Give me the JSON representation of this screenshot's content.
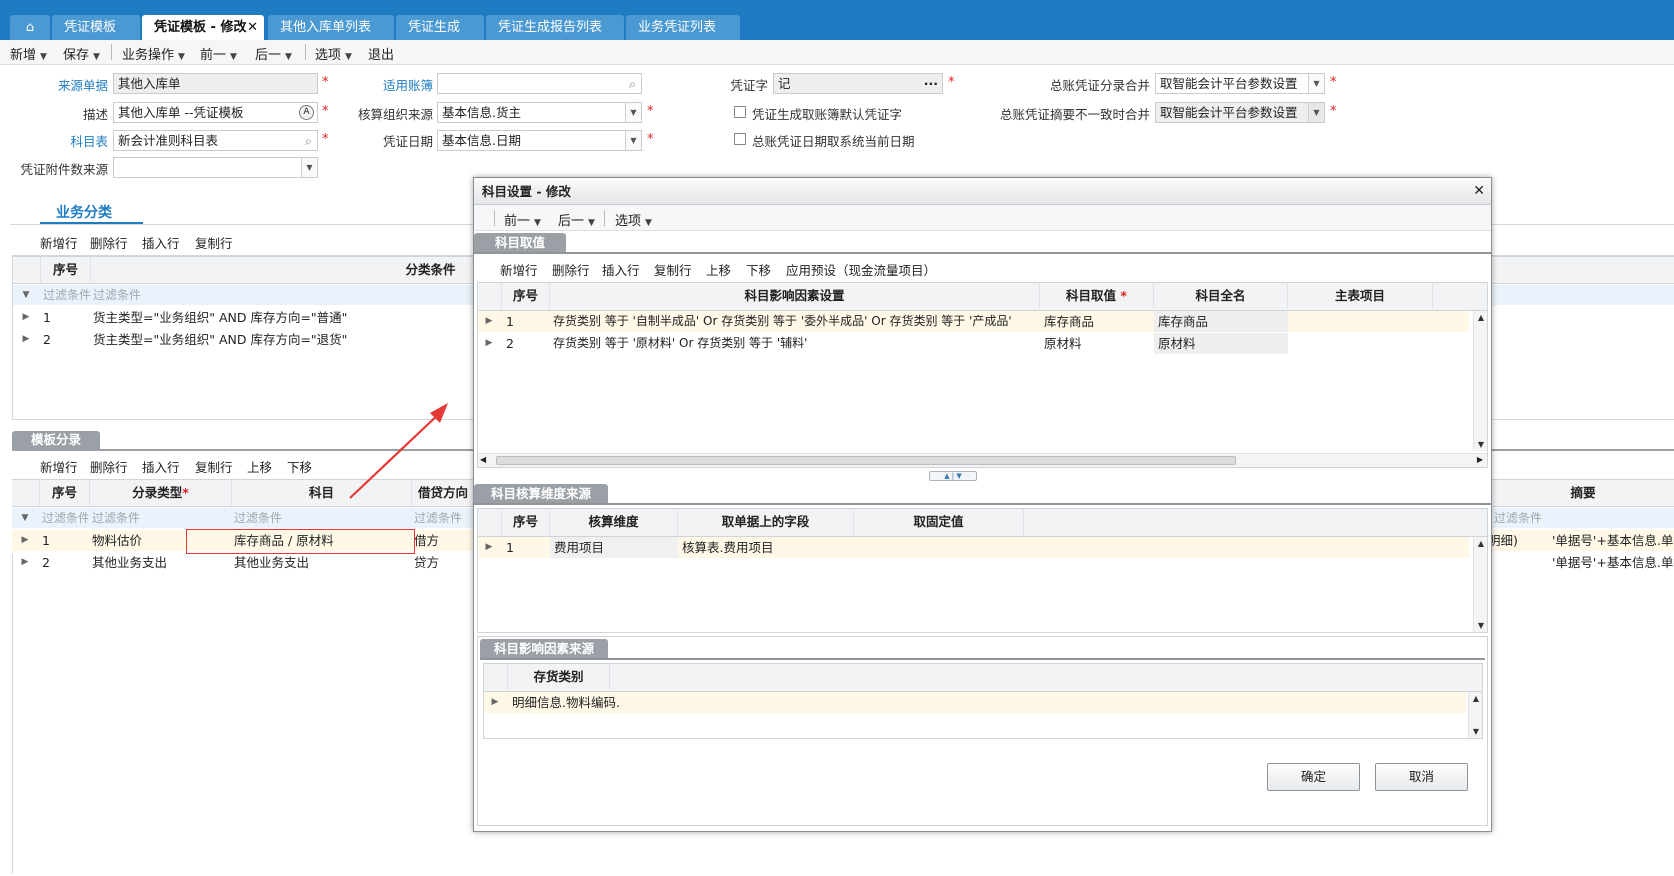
{
  "tabs": [
    {
      "label": "凭证模板"
    },
    {
      "label": "凭证模板 - 修改"
    },
    {
      "label": "其他入库单列表"
    },
    {
      "label": "凭证生成"
    },
    {
      "label": "凭证生成报告列表"
    },
    {
      "label": "业务凭证列表"
    }
  ],
  "toolbar": {
    "new": "新增",
    "save": "保存",
    "business_ops": "业务操作",
    "prev": "前一",
    "next": "后一",
    "options": "选项",
    "exit": "退出"
  },
  "form": {
    "source_doc_label": "来源单据",
    "source_doc_value": "其他入库单",
    "desc_label": "描述",
    "desc_value": "其他入库单 --凭证模板",
    "chart_label": "科目表",
    "chart_value": "新会计准则科目表",
    "attach_label": "凭证附件数来源",
    "attach_value": "",
    "book_label": "适用账簿",
    "book_value": "",
    "org_label": "核算组织来源",
    "org_value": "基本信息.货主",
    "date_label": "凭证日期",
    "date_value": "基本信息.日期",
    "word_label": "凭证字",
    "word_value": "记",
    "word_btn": "···",
    "chk1_label": "凭证生成取账簿默认凭证字",
    "chk2_label": "总账凭证日期取系统当前日期",
    "merge_label": "总账凭证分录合并",
    "merge_value": "取智能会计平台参数设置",
    "summary_label": "总账凭证摘要不一致时合并",
    "summary_value": "取智能会计平台参数设置"
  },
  "biz": {
    "tab_label": "业务分类",
    "actions": [
      "新增行",
      "删除行",
      "插入行",
      "复制行"
    ],
    "col_no": "序号",
    "col_cond": "分类条件",
    "filter_a": "过滤条件",
    "filter_b": "过滤条件",
    "rows": [
      {
        "no": "1",
        "cond": "货主类型=\"业务组织\" AND 库存方向=\"普通\""
      },
      {
        "no": "2",
        "cond": "货主类型=\"业务组织\" AND 库存方向=\"退货\""
      }
    ]
  },
  "entry": {
    "tab_label": "模板分录",
    "actions": [
      "新增行",
      "删除行",
      "插入行",
      "复制行",
      "上移",
      "下移"
    ],
    "col_no": "序号",
    "col_type": "分录类型",
    "col_subject": "科目",
    "col_dir": "借贷方向",
    "col_summary": "摘要",
    "filter": "过滤条件",
    "rows": [
      {
        "no": "1",
        "type": "物料估价",
        "subject": "库存商品 / 原材料",
        "dir": "借方",
        "right_a": "明细)",
        "right_b": "'单据号'+基本信息.单据"
      },
      {
        "no": "2",
        "type": "其他业务支出",
        "subject": "其他业务支出",
        "dir": "贷方",
        "right_b": "'单据号'+基本信息.单据"
      }
    ]
  },
  "dialog": {
    "title": "科目设置 - 修改",
    "close": "✕",
    "toolbar": {
      "prev": "前一",
      "next": "后一",
      "options": "选项"
    },
    "sec1_tab": "科目取值",
    "sec1_actions": [
      "新增行",
      "删除行",
      "插入行",
      "复制行",
      "上移",
      "下移",
      "应用预设（现金流量项目）"
    ],
    "sec1_cols": {
      "no": "序号",
      "factor": "科目影响因素设置",
      "value": "科目取值",
      "fullname": "科目全名",
      "main": "主表项目"
    },
    "sec1_rows": [
      {
        "no": "1",
        "factor": "存货类别   等于   '自制半成品'   Or     存货类别   等于   '委外半成品'  Or 存货类别   等于  '产成品'",
        "value": "库存商品",
        "fullname": "库存商品"
      },
      {
        "no": "2",
        "factor": "存货类别   等于   '原材料'   Or     存货类别   等于   '辅料'",
        "value": "原材料",
        "fullname": "原材料"
      }
    ],
    "sec2_tab": "科目核算维度来源",
    "sec2_cols": {
      "no": "序号",
      "dim": "核算维度",
      "field": "取单据上的字段",
      "fixed": "取固定值"
    },
    "sec2_rows": [
      {
        "no": "1",
        "dim": "费用项目",
        "field": "核算表.费用项目",
        "fixed": ""
      }
    ],
    "sec3_tab": "科目影响因素来源",
    "sec3_col": "存货类别",
    "sec3_rows": [
      {
        "value": "明细信息.物料编码."
      }
    ],
    "ok": "确定",
    "cancel": "取消"
  },
  "colors": {
    "brand": "#1f7cc2",
    "tab_inactive": "#4a99d3",
    "required": "#e02020",
    "annotation": "#e53935"
  }
}
